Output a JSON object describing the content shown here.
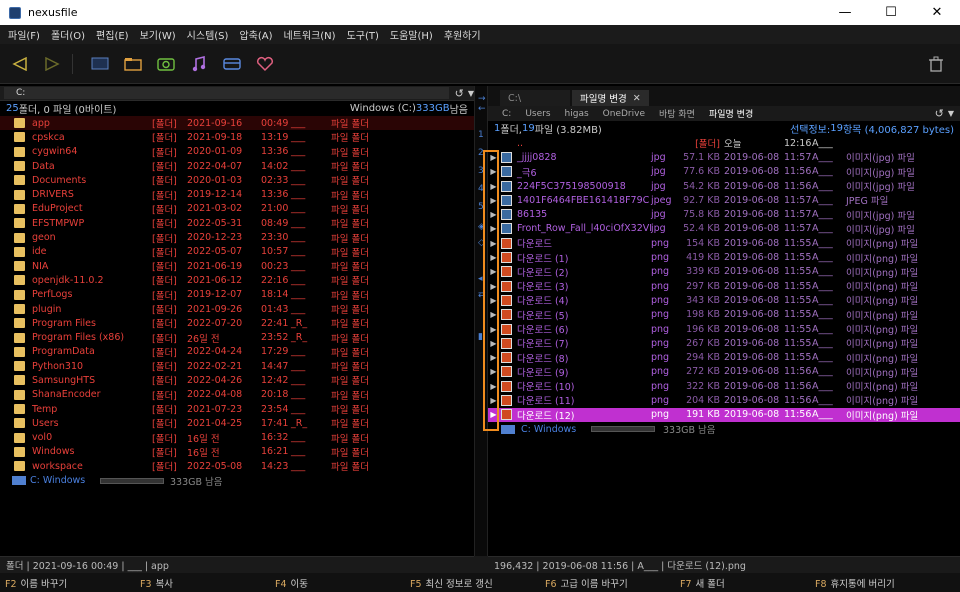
{
  "window": {
    "title": "nexusfile"
  },
  "menu": [
    "파일(F)",
    "폴더(O)",
    "편집(E)",
    "보기(W)",
    "시스템(S)",
    "압축(A)",
    "네트워크(N)",
    "도구(T)",
    "도움말(H)",
    "후원하기"
  ],
  "toolbar": {
    "icons": [
      "back-arrow-icon",
      "forward-arrow-icon",
      "monitor-icon",
      "folder-icon",
      "camera-icon",
      "music-note-icon",
      "card-icon",
      "heart-icon",
      "trash-icon"
    ]
  },
  "left": {
    "path": "C:",
    "info_dirs": "25",
    "info_text": " 폴더, 0 파일 (0바이트)",
    "drive_text": "Windows (C:) ",
    "drive_size": "333GB",
    "drive_left": " 남음",
    "rows": [
      {
        "name": "app",
        "type": "[폴더]",
        "date": "2021-09-16",
        "time": "00:49",
        "attr": "___",
        "desc": "파일 폴더"
      },
      {
        "name": "cpskca",
        "type": "[폴더]",
        "date": "2021-09-18",
        "time": "13:19",
        "attr": "___",
        "desc": "파일 폴더"
      },
      {
        "name": "cygwin64",
        "type": "[폴더]",
        "date": "2020-01-09",
        "time": "13:36",
        "attr": "___",
        "desc": "파일 폴더"
      },
      {
        "name": "Data",
        "type": "[폴더]",
        "date": "2022-04-07",
        "time": "14:02",
        "attr": "___",
        "desc": "파일 폴더"
      },
      {
        "name": "Documents",
        "type": "[폴더]",
        "date": "2020-01-03",
        "time": "02:33",
        "attr": "___",
        "desc": "파일 폴더"
      },
      {
        "name": "DRIVERS",
        "type": "[폴더]",
        "date": "2019-12-14",
        "time": "13:36",
        "attr": "___",
        "desc": "파일 폴더"
      },
      {
        "name": "EduProject",
        "type": "[폴더]",
        "date": "2021-03-02",
        "time": "21:00",
        "attr": "___",
        "desc": "파일 폴더"
      },
      {
        "name": "EFSTMPWP",
        "type": "[폴더]",
        "date": "2022-05-31",
        "time": "08:49",
        "attr": "___",
        "desc": "파일 폴더"
      },
      {
        "name": "geon",
        "type": "[폴더]",
        "date": "2020-12-23",
        "time": "23:30",
        "attr": "___",
        "desc": "파일 폴더"
      },
      {
        "name": "ide",
        "type": "[폴더]",
        "date": "2022-05-07",
        "time": "10:57",
        "attr": "___",
        "desc": "파일 폴더"
      },
      {
        "name": "NIA",
        "type": "[폴더]",
        "date": "2021-06-19",
        "time": "00:23",
        "attr": "___",
        "desc": "파일 폴더"
      },
      {
        "name": "openjdk-11.0.2",
        "type": "[폴더]",
        "date": "2021-06-12",
        "time": "22:16",
        "attr": "___",
        "desc": "파일 폴더"
      },
      {
        "name": "PerfLogs",
        "type": "[폴더]",
        "date": "2019-12-07",
        "time": "18:14",
        "attr": "___",
        "desc": "파일 폴더"
      },
      {
        "name": "plugin",
        "type": "[폴더]",
        "date": "2021-09-26",
        "time": "01:43",
        "attr": "___",
        "desc": "파일 폴더"
      },
      {
        "name": "Program Files",
        "type": "[폴더]",
        "date": "2022-07-20",
        "time": "22:41",
        "attr": "_R_",
        "desc": "파일 폴더"
      },
      {
        "name": "Program Files (x86)",
        "type": "[폴더]",
        "date": "26일 전",
        "time": "23:52",
        "attr": "_R_",
        "desc": "파일 폴더"
      },
      {
        "name": "ProgramData",
        "type": "[폴더]",
        "date": "2022-04-24",
        "time": "17:29",
        "attr": "___",
        "desc": "파일 폴더"
      },
      {
        "name": "Python310",
        "type": "[폴더]",
        "date": "2022-02-21",
        "time": "14:47",
        "attr": "___",
        "desc": "파일 폴더"
      },
      {
        "name": "SamsungHTS",
        "type": "[폴더]",
        "date": "2022-04-26",
        "time": "12:42",
        "attr": "___",
        "desc": "파일 폴더"
      },
      {
        "name": "ShanaEncoder",
        "type": "[폴더]",
        "date": "2022-04-08",
        "time": "20:18",
        "attr": "___",
        "desc": "파일 폴더"
      },
      {
        "name": "Temp",
        "type": "[폴더]",
        "date": "2021-07-23",
        "time": "23:54",
        "attr": "___",
        "desc": "파일 폴더"
      },
      {
        "name": "Users",
        "type": "[폴더]",
        "date": "2021-04-25",
        "time": "17:41",
        "attr": "_R_",
        "desc": "파일 폴더"
      },
      {
        "name": "vol0",
        "type": "[폴더]",
        "date": "16일 전",
        "time": "16:32",
        "attr": "___",
        "desc": "파일 폴더"
      },
      {
        "name": "Windows",
        "type": "[폴더]",
        "date": "16일 전",
        "time": "16:21",
        "attr": "___",
        "desc": "파일 폴더"
      },
      {
        "name": "workspace",
        "type": "[폴더]",
        "date": "2022-05-08",
        "time": "14:23",
        "attr": "___",
        "desc": "파일 폴더"
      }
    ],
    "drive_row": {
      "name": "C: Windows",
      "free": "333GB 남음"
    },
    "status": "폴더 | 2021-09-16 00:49 | ___ | app"
  },
  "right": {
    "tabs": [
      "C:\\",
      "파일명 변경"
    ],
    "crumbs": [
      "C:",
      "Users",
      "higas",
      "OneDrive",
      "바탕 화면",
      "파일명 변경"
    ],
    "info_dirs": "1",
    "info_text": " 폴더, ",
    "info_files": "19",
    "info_text2": " 파일 (3.82MB)",
    "sel_label": "선택정보: ",
    "sel_count": "19",
    "sel_text": " 항목 (4,006,827 bytes)",
    "parent_row": {
      "name": "..",
      "type": "[폴더]",
      "date": "오늘",
      "time": "12:16",
      "attr": "A___"
    },
    "rows": [
      {
        "name": "_jjjj0828",
        "ext": "jpg",
        "size": "57.1 KB",
        "date": "2019-06-08",
        "time": "11:57",
        "attr": "A___",
        "desc": "이미지(jpg) 파일"
      },
      {
        "name": "_극6",
        "ext": "jpg",
        "size": "77.6 KB",
        "date": "2019-06-08",
        "time": "11:56",
        "attr": "A___",
        "desc": "이미지(jpg) 파일"
      },
      {
        "name": "224F5C375198500918",
        "ext": "jpg",
        "size": "54.2 KB",
        "date": "2019-06-08",
        "time": "11:56",
        "attr": "A___",
        "desc": "이미지(jpg) 파일"
      },
      {
        "name": "1401F6464FBE161418F79C",
        "ext": "jpeg",
        "size": "92.7 KB",
        "date": "2019-06-08",
        "time": "11:57",
        "attr": "A___",
        "desc": "JPEG 파일"
      },
      {
        "name": "86135",
        "ext": "jpg",
        "size": "75.8 KB",
        "date": "2019-06-08",
        "time": "11:57",
        "attr": "A___",
        "desc": "이미지(jpg) 파일"
      },
      {
        "name": "Front_Row_Fall_l40ciOfX32VI",
        "ext": "jpg",
        "size": "52.4 KB",
        "date": "2019-06-08",
        "time": "11:57",
        "attr": "A___",
        "desc": "이미지(jpg) 파일"
      },
      {
        "name": "다운로드",
        "ext": "png",
        "size": "154 KB",
        "date": "2019-06-08",
        "time": "11:55",
        "attr": "A___",
        "desc": "이미지(png) 파일"
      },
      {
        "name": "다운로드 (1)",
        "ext": "png",
        "size": "419 KB",
        "date": "2019-06-08",
        "time": "11:55",
        "attr": "A___",
        "desc": "이미지(png) 파일"
      },
      {
        "name": "다운로드 (2)",
        "ext": "png",
        "size": "339 KB",
        "date": "2019-06-08",
        "time": "11:55",
        "attr": "A___",
        "desc": "이미지(png) 파일"
      },
      {
        "name": "다운로드 (3)",
        "ext": "png",
        "size": "297 KB",
        "date": "2019-06-08",
        "time": "11:55",
        "attr": "A___",
        "desc": "이미지(png) 파일"
      },
      {
        "name": "다운로드 (4)",
        "ext": "png",
        "size": "343 KB",
        "date": "2019-06-08",
        "time": "11:55",
        "attr": "A___",
        "desc": "이미지(png) 파일"
      },
      {
        "name": "다운로드 (5)",
        "ext": "png",
        "size": "198 KB",
        "date": "2019-06-08",
        "time": "11:55",
        "attr": "A___",
        "desc": "이미지(png) 파일"
      },
      {
        "name": "다운로드 (6)",
        "ext": "png",
        "size": "196 KB",
        "date": "2019-06-08",
        "time": "11:55",
        "attr": "A___",
        "desc": "이미지(png) 파일"
      },
      {
        "name": "다운로드 (7)",
        "ext": "png",
        "size": "267 KB",
        "date": "2019-06-08",
        "time": "11:55",
        "attr": "A___",
        "desc": "이미지(png) 파일"
      },
      {
        "name": "다운로드 (8)",
        "ext": "png",
        "size": "294 KB",
        "date": "2019-06-08",
        "time": "11:55",
        "attr": "A___",
        "desc": "이미지(png) 파일"
      },
      {
        "name": "다운로드 (9)",
        "ext": "png",
        "size": "272 KB",
        "date": "2019-06-08",
        "time": "11:56",
        "attr": "A___",
        "desc": "이미지(png) 파일"
      },
      {
        "name": "다운로드 (10)",
        "ext": "png",
        "size": "322 KB",
        "date": "2019-06-08",
        "time": "11:56",
        "attr": "A___",
        "desc": "이미지(png) 파일"
      },
      {
        "name": "다운로드 (11)",
        "ext": "png",
        "size": "204 KB",
        "date": "2019-06-08",
        "time": "11:56",
        "attr": "A___",
        "desc": "이미지(png) 파일"
      },
      {
        "name": "다운로드 (12)",
        "ext": "png",
        "size": "191 KB",
        "date": "2019-06-08",
        "time": "11:56",
        "attr": "A___",
        "desc": "이미지(png) 파일"
      }
    ],
    "drive_row": {
      "name": "C: Windows",
      "free": "333GB 남음"
    },
    "status": "196,432 | 2019-06-08 11:56 | A___ | 다운로드 (12).png"
  },
  "divider_numbers": [
    "1",
    "2",
    "3",
    "4",
    "5"
  ],
  "fkeys": [
    {
      "key": "F2",
      "label": "이름 바꾸기"
    },
    {
      "key": "F3",
      "label": "복사"
    },
    {
      "key": "F4",
      "label": "이동"
    },
    {
      "key": "F5",
      "label": "최신 정보로 갱신"
    },
    {
      "key": "F6",
      "label": "고급 이름 바꾸기"
    },
    {
      "key": "F7",
      "label": "새 폴더"
    },
    {
      "key": "F8",
      "label": "휴지통에 버리기"
    }
  ],
  "colors": {
    "selected_row": "#c030d0",
    "highlight_box": "#f08c1e",
    "accent_blue": "#5aa0ff"
  }
}
